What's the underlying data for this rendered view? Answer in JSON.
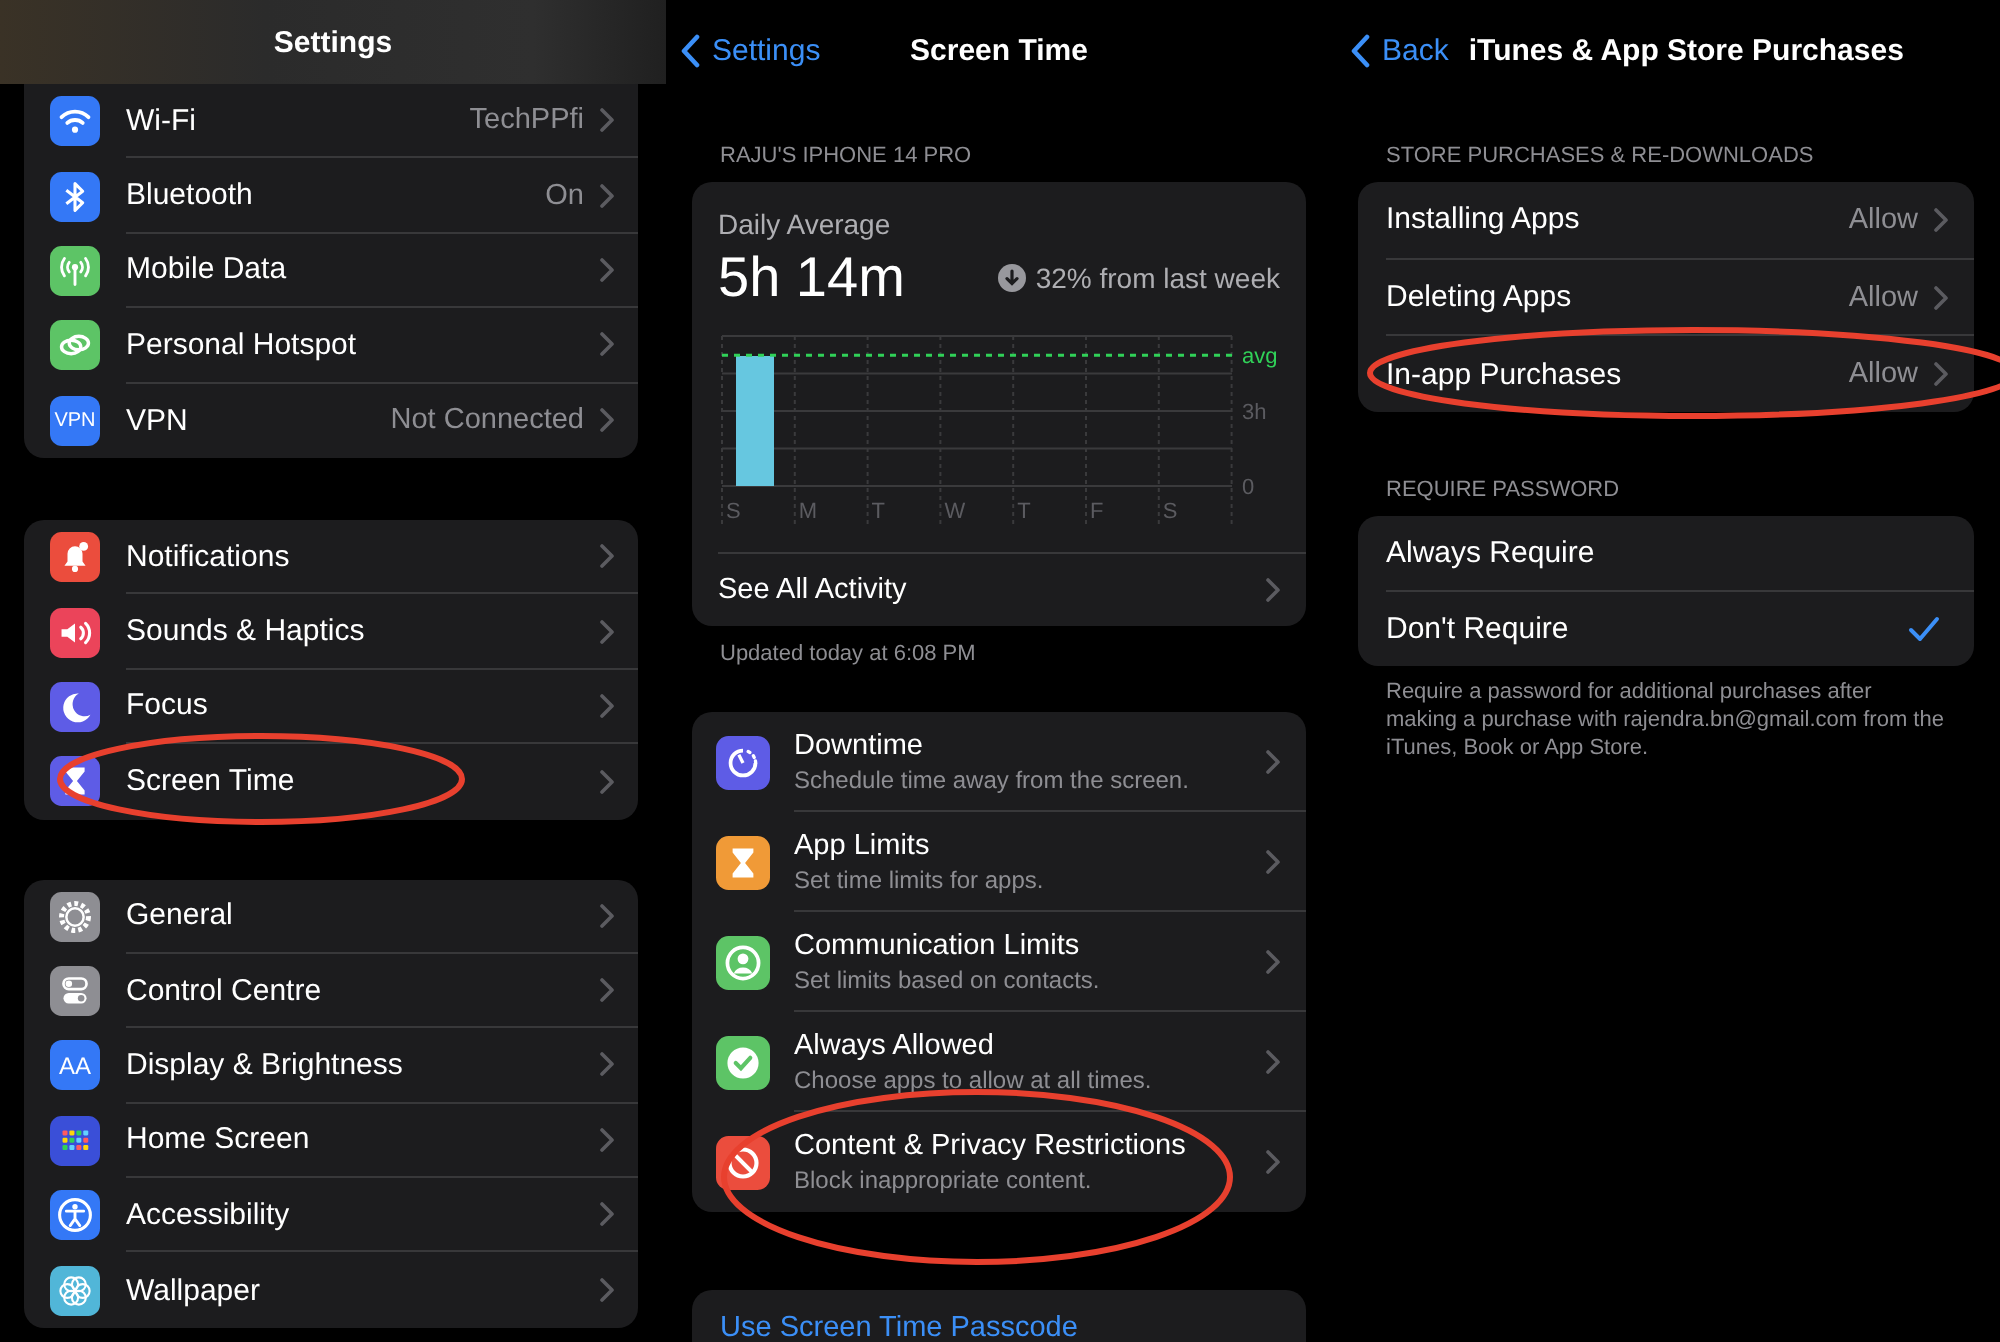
{
  "settings": {
    "title": "Settings",
    "groups": [
      {
        "items": [
          {
            "label": "Wi-Fi",
            "value": "TechPPfi",
            "color": "#3478f6",
            "circled": false
          },
          {
            "label": "Bluetooth",
            "value": "On",
            "color": "#3478f6",
            "circled": false
          },
          {
            "label": "Mobile Data",
            "color": "#5dc466",
            "circled": false
          },
          {
            "label": "Personal Hotspot",
            "color": "#5dc466",
            "circled": false
          },
          {
            "label": "VPN",
            "value": "Not Connected",
            "icon_text": "VPN",
            "color": "#3478f6",
            "circled": false
          }
        ]
      },
      {
        "items": [
          {
            "label": "Notifications",
            "color": "#eb4d3d",
            "circled": false
          },
          {
            "label": "Sounds & Haptics",
            "color": "#eb445a",
            "circled": false
          },
          {
            "label": "Focus",
            "color": "#5e5ce6",
            "circled": false
          },
          {
            "label": "Screen Time",
            "color": "#5e5ce6",
            "circled": true
          }
        ]
      },
      {
        "items": [
          {
            "label": "General",
            "color": "#8e8e93",
            "circled": false
          },
          {
            "label": "Control Centre",
            "color": "#8e8e93",
            "circled": false
          },
          {
            "label": "Display & Brightness",
            "icon_text": "AA",
            "color": "#3478f6",
            "circled": false
          },
          {
            "label": "Home Screen",
            "color": "#3a4fd8",
            "circled": false
          },
          {
            "label": "Accessibility",
            "color": "#3478f6",
            "circled": false
          },
          {
            "label": "Wallpaper",
            "color": "#51b6d8",
            "circled": false
          }
        ]
      }
    ]
  },
  "screen_time": {
    "back": "Settings",
    "title": "Screen Time",
    "device": "RAJU'S IPHONE 14 PRO",
    "summary": {
      "label": "Daily Average",
      "value": "5h 14m",
      "change": "32% from last week",
      "chart_data": {
        "type": "bar",
        "categories": [
          "S",
          "M",
          "T",
          "W",
          "T",
          "F",
          "S"
        ],
        "values": [
          5.2,
          null,
          null,
          null,
          null,
          null,
          null
        ],
        "ylim": [
          0,
          6
        ],
        "yticks": [
          {
            "value": 0,
            "label": "0"
          },
          {
            "value": 3,
            "label": "3h"
          }
        ],
        "ref_lines": [
          {
            "axis": "y",
            "value": 5.23,
            "label": "avg",
            "color": "#30d158"
          }
        ]
      },
      "link": "See All Activity"
    },
    "updated": "Updated today at 6:08 PM",
    "items": [
      {
        "title": "Downtime",
        "subtitle": "Schedule time away from the screen.",
        "color": "#5e5ce6",
        "circled": false
      },
      {
        "title": "App Limits",
        "subtitle": "Set time limits for apps.",
        "color": "#f09a37",
        "circled": false
      },
      {
        "title": "Communication Limits",
        "subtitle": "Set limits based on contacts.",
        "color": "#5dc466",
        "circled": false
      },
      {
        "title": "Always Allowed",
        "subtitle": "Choose apps to allow at all times.",
        "color": "#5dc466",
        "circled": false
      },
      {
        "title": "Content & Privacy Restrictions",
        "subtitle": "Block inappropriate content.",
        "color": "#eb4d3d",
        "circled": true
      }
    ],
    "passcode": "Use Screen Time Passcode"
  },
  "purchases": {
    "back": "Back",
    "title": "iTunes & App Store Purchases",
    "store_header": "STORE PURCHASES & RE-DOWNLOADS",
    "store_items": [
      {
        "label": "Installing Apps",
        "value": "Allow",
        "circled": false
      },
      {
        "label": "Deleting Apps",
        "value": "Allow",
        "circled": false
      },
      {
        "label": "In-app Purchases",
        "value": "Allow",
        "circled": true
      }
    ],
    "password_header": "REQUIRE PASSWORD",
    "password_options": [
      {
        "label": "Always Require",
        "selected": false
      },
      {
        "label": "Don't Require",
        "selected": true
      }
    ],
    "footer": "Require a password for additional purchases after making a purchase with rajendra.bn@gmail.com from the iTunes, Book or App Store."
  }
}
